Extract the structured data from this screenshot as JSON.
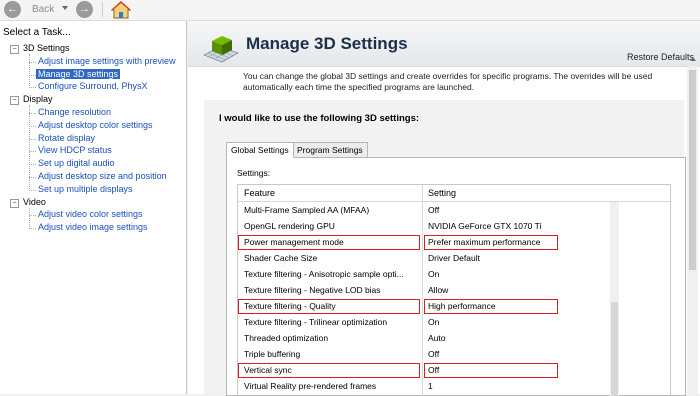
{
  "toolbar": {
    "back_label": "Back"
  },
  "left_panel": {
    "header": "Select a Task...",
    "categories": [
      {
        "label": "3D Settings",
        "items": [
          "Adjust image settings with preview",
          "Manage 3D settings",
          "Configure Surround, PhysX"
        ]
      },
      {
        "label": "Display",
        "items": [
          "Change resolution",
          "Adjust desktop color settings",
          "Rotate display",
          "View HDCP status",
          "Set up digital audio",
          "Adjust desktop size and position",
          "Set up multiple displays"
        ]
      },
      {
        "label": "Video",
        "items": [
          "Adjust video color settings",
          "Adjust video image settings"
        ]
      }
    ],
    "selected": "Manage 3D settings"
  },
  "page": {
    "title": "Manage 3D Settings",
    "restore_defaults": "Restore Defaults",
    "description": "You can change the global 3D settings and create overrides for specific programs. The overrides will be used automatically each time the specified programs are launched.",
    "prompt": "I would like to use the following 3D settings:",
    "tabs": [
      "Global Settings",
      "Program Settings"
    ],
    "active_tab": "Global Settings",
    "settings_label": "Settings:",
    "columns": [
      "Feature",
      "Setting"
    ],
    "rows": [
      {
        "feature": "Multi-Frame Sampled AA (MFAA)",
        "setting": "Off",
        "highlight": false
      },
      {
        "feature": "OpenGL rendering GPU",
        "setting": "NVIDIA GeForce GTX 1070 Ti",
        "highlight": false
      },
      {
        "feature": "Power management mode",
        "setting": "Prefer maximum performance",
        "highlight": true
      },
      {
        "feature": "Shader Cache Size",
        "setting": "Driver Default",
        "highlight": false
      },
      {
        "feature": "Texture filtering - Anisotropic sample opti...",
        "setting": "On",
        "highlight": false
      },
      {
        "feature": "Texture filtering - Negative LOD bias",
        "setting": "Allow",
        "highlight": false
      },
      {
        "feature": "Texture filtering - Quality",
        "setting": "High performance",
        "highlight": true
      },
      {
        "feature": "Texture filtering - Trilinear optimization",
        "setting": "On",
        "highlight": false
      },
      {
        "feature": "Threaded optimization",
        "setting": "Auto",
        "highlight": false
      },
      {
        "feature": "Triple buffering",
        "setting": "Off",
        "highlight": false
      },
      {
        "feature": "Vertical sync",
        "setting": "Off",
        "highlight": true
      },
      {
        "feature": "Virtual Reality pre-rendered frames",
        "setting": "1",
        "highlight": false
      }
    ]
  },
  "colors": {
    "highlight_border": "#d62020",
    "selection": "#3168c4",
    "link": "#1a50b8"
  }
}
